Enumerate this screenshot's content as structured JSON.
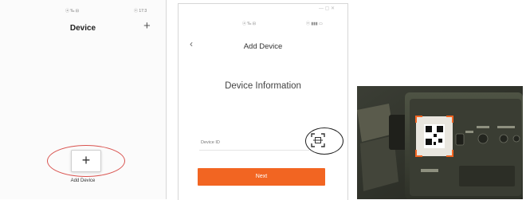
{
  "device_list": {
    "status_left": "ⓐ ‰ ⊟",
    "status_right": "ⓔ 17:3",
    "title": "Device",
    "add_icon": "plus-icon",
    "add_button_glyph": "+",
    "add_label": "Add Device"
  },
  "add_device": {
    "window_controls": "— ▢ ✕",
    "status_mid": "ⓐ ‰ ⊟",
    "status_right": "ⓔ ▮▮▮ ▭",
    "back_glyph": "‹",
    "title": "Add Device",
    "section_title": "Device Information",
    "device_id_placeholder": "Device ID",
    "scan_icon": "qr-scan-icon",
    "next_label": "Next",
    "accent_color": "#f26522"
  },
  "photo": {
    "description_icon": "camera-qr-photo",
    "qr_highlight_color": "#f26522"
  }
}
